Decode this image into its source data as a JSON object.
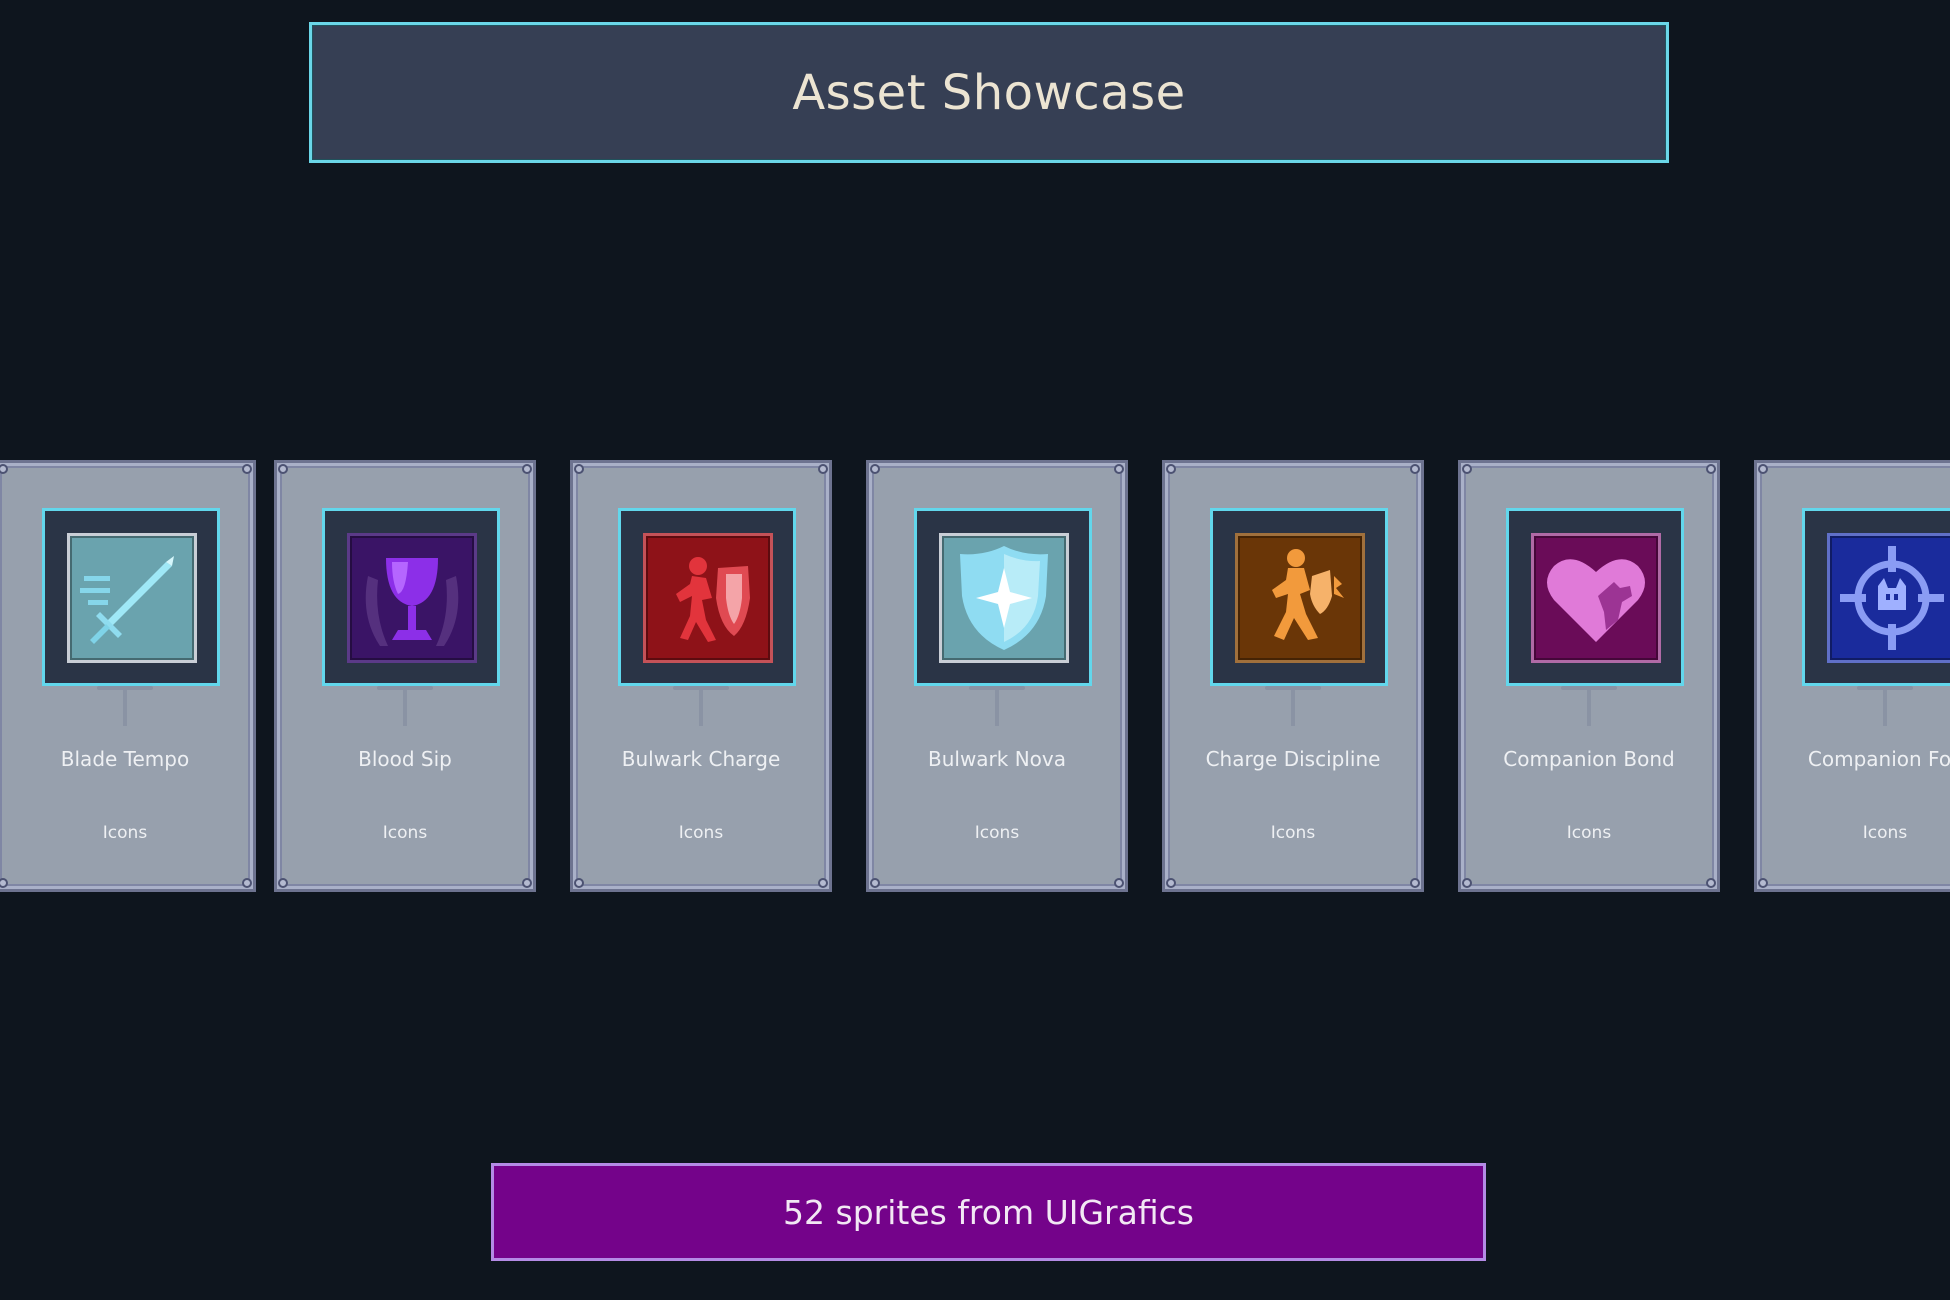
{
  "header": {
    "title": "Asset Showcase"
  },
  "cards": [
    {
      "name": "Blade Tempo",
      "category": "Icons",
      "icon": "sword-icon",
      "tile_color": "#6aa3ae"
    },
    {
      "name": "Blood Sip",
      "category": "Icons",
      "icon": "chalice-icon",
      "tile_color": "#3a1466"
    },
    {
      "name": "Bulwark Charge",
      "category": "Icons",
      "icon": "charging-shield-icon",
      "tile_color": "#8e1218"
    },
    {
      "name": "Bulwark Nova",
      "category": "Icons",
      "icon": "star-shield-icon",
      "tile_color": "#6aa3ae"
    },
    {
      "name": "Charge Discipline",
      "category": "Icons",
      "icon": "warrior-icon",
      "tile_color": "#6a3607"
    },
    {
      "name": "Companion Bond",
      "category": "Icons",
      "icon": "heart-dog-icon",
      "tile_color": "#6a0c58"
    },
    {
      "name": "Companion Foc",
      "category": "Icons",
      "icon": "crosshair-icon",
      "tile_color": "#1a2b9c"
    }
  ],
  "footer": {
    "text": "52 sprites from UIGrafics"
  },
  "colors": {
    "background": "#0e151e",
    "title_panel": "#363f54",
    "accent_cyan": "#6ad6e8",
    "card": "#97a0ad",
    "footer_bar": "#74038a",
    "footer_border": "#b48be6"
  }
}
